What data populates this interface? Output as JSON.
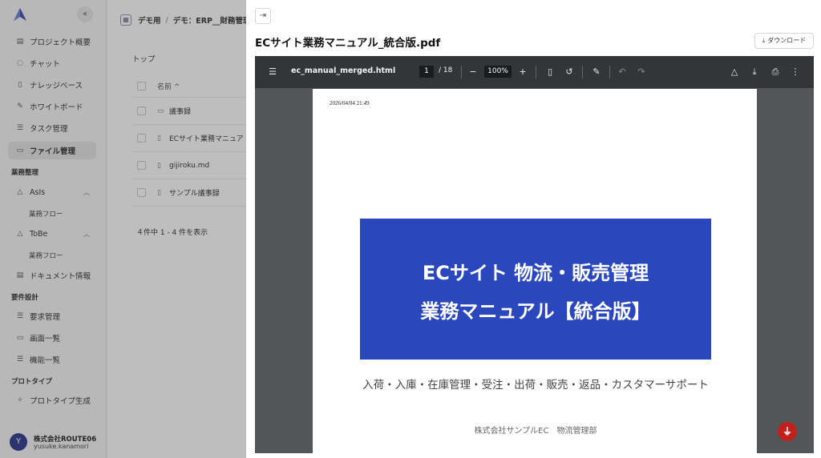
{
  "sidebar": {
    "collapse_icon": "«",
    "items": [
      {
        "label": "プロジェクト概要",
        "icon": "document-icon"
      },
      {
        "label": "チャット",
        "icon": "chat-icon"
      },
      {
        "label": "ナレッジベース",
        "icon": "book-icon"
      },
      {
        "label": "ホワイトボード",
        "icon": "pen-icon"
      },
      {
        "label": "タスク管理",
        "icon": "list-icon"
      },
      {
        "label": "ファイル管理",
        "icon": "folder-icon"
      }
    ],
    "sections": {
      "business": "業務整理",
      "requirements": "要件設計",
      "prototype": "プロトタイプ"
    },
    "asis": {
      "label": "AsIs",
      "sub": "業務フロー"
    },
    "tobe": {
      "label": "ToBe",
      "sub": "業務フロー"
    },
    "doc_info": "ドキュメント情報",
    "req_items": [
      "要求管理",
      "画面一覧",
      "機能一覧"
    ],
    "proto_item": "プロトタイプ生成",
    "user": {
      "initial": "Y",
      "company": "株式会社ROUTE06",
      "id": "yusuke.kanamori"
    }
  },
  "main": {
    "breadcrumb": [
      "デモ用",
      "デモ：ERP__財務管理"
    ],
    "top_label": "トップ",
    "table_header": "名前 ^",
    "files": [
      {
        "name": "議事録",
        "icon": "folder-icon"
      },
      {
        "name": "ECサイト業務マニュア",
        "icon": "file-icon"
      },
      {
        "name": "gijiroku.md",
        "icon": "file-icon"
      },
      {
        "name": "サンプル議事録",
        "icon": "file-icon"
      }
    ],
    "count_text": "４件中 1 - 4 件を表示"
  },
  "viewer": {
    "title": "ECサイト業務マニュアル_統合版.pdf",
    "download_label": "ダウンロード",
    "file_name": "ec_manual_merged.html",
    "page_current": "1",
    "page_total": "/ 18",
    "zoom": "100%",
    "page": {
      "timestamp": "2026/04/04 21:49",
      "banner_line1": "ECサイト 物流・販売管理",
      "banner_line2": "業務マニュアル【統合版】",
      "subtitle": "入荷・入庫・在庫管理・受注・出荷・販売・返品・カスタマーサポート",
      "org": "株式会社サンプルEC　物流管理部"
    },
    "colors": {
      "toolbar": "#323639",
      "background": "#525659",
      "banner": "#2a47bd",
      "acrobat": "#c0211c"
    }
  }
}
